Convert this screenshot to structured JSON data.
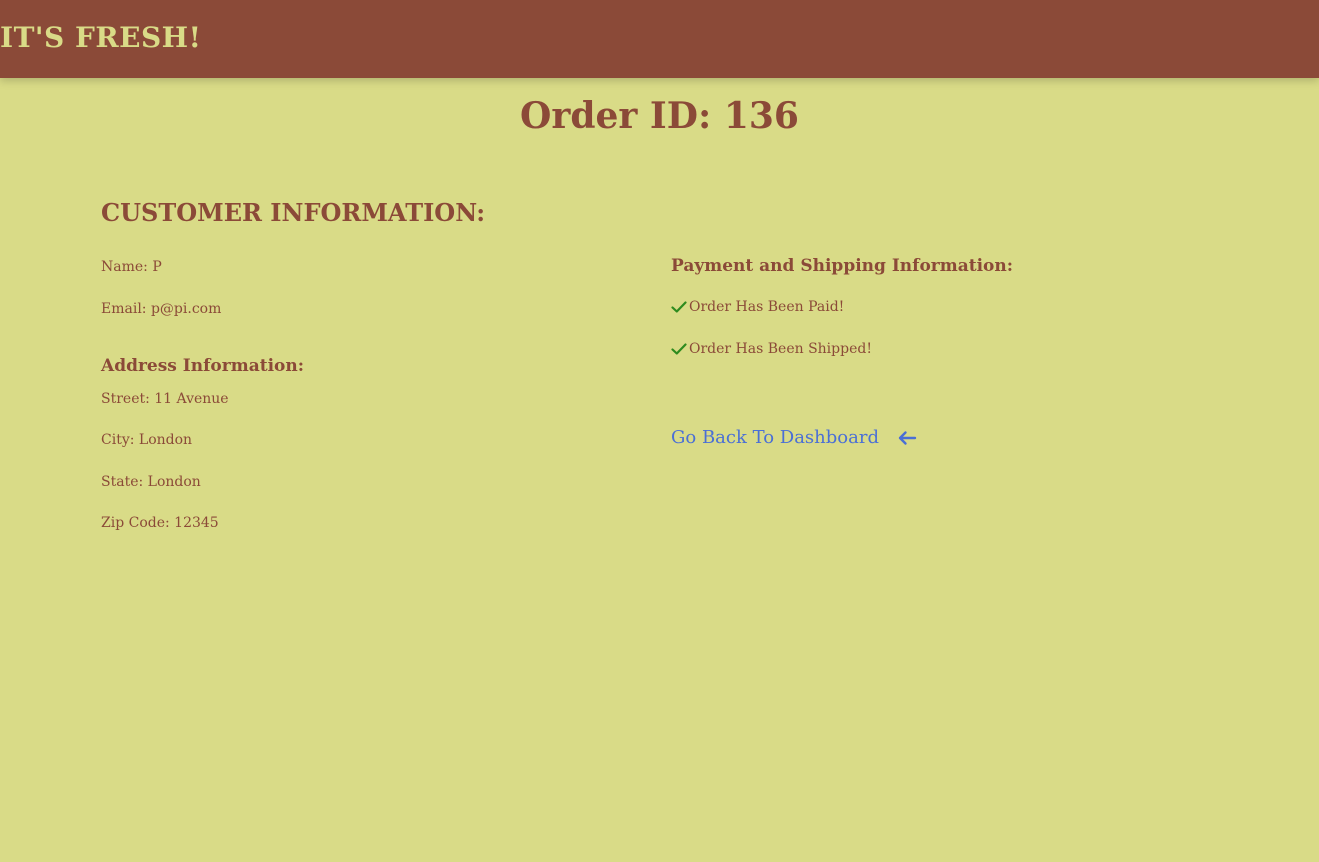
{
  "header": {
    "brand": "IT'S FRESH!"
  },
  "order": {
    "title": "Order ID: 136"
  },
  "customer": {
    "section_title": "CUSTOMER INFORMATION:",
    "name": "Name: P",
    "email": "Email: p@pi.com"
  },
  "address": {
    "title": "Address Information:",
    "street": "Street: 11 Avenue",
    "city": "City: London",
    "state": "State: London",
    "zip": "Zip Code: 12345"
  },
  "payment": {
    "title": "Payment and Shipping Information:",
    "paid": "Order Has Been Paid!",
    "shipped": "Order Has Been Shipped!"
  },
  "navigation": {
    "back_label": "Go Back To Dashboard"
  },
  "icons": {
    "check": "check-icon",
    "back_arrow": "arrow-left-icon"
  },
  "colors": {
    "header_bg": "#8b4a38",
    "page_bg": "#d9db87",
    "text": "#8b4a38",
    "link": "#4a6fd6",
    "check": "#2e8b1e"
  }
}
